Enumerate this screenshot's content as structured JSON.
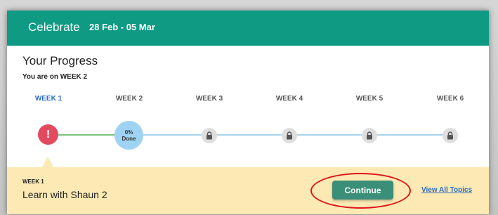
{
  "header": {
    "title": "Celebrate",
    "dates": "28 Feb - 05 Mar"
  },
  "progress": {
    "title": "Your Progress",
    "subtitle": "You are on WEEK 2"
  },
  "weeks": [
    {
      "label": "WEEK 1",
      "state": "alert",
      "badge": "!"
    },
    {
      "label": "WEEK 2",
      "state": "current",
      "percent": "0%",
      "status": "Done"
    },
    {
      "label": "WEEK 3",
      "state": "locked"
    },
    {
      "label": "WEEK 4",
      "state": "locked"
    },
    {
      "label": "WEEK 5",
      "state": "locked"
    },
    {
      "label": "WEEK 6",
      "state": "locked"
    }
  ],
  "footer": {
    "week": "WEEK 1",
    "topic": "Learn with Shaun 2",
    "continue_label": "Continue",
    "view_all_label": "View All Topics"
  },
  "colors": {
    "header": "#0e9a83",
    "footer": "#fce9b3",
    "alert": "#e24b5f",
    "current": "#9fd3f3",
    "locked": "#dedede",
    "button": "#3b8f78",
    "link": "#2a6ac4",
    "highlight": "#e0141b"
  },
  "icons": {
    "alert": "exclamation-icon",
    "locked": "lock-icon"
  }
}
